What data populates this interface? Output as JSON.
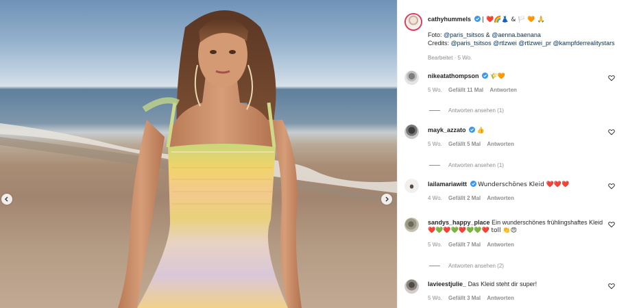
{
  "post": {
    "nav_prev_icon": "chevron-left-icon",
    "nav_next_icon": "chevron-right-icon"
  },
  "caption": {
    "username": "cathyhummels",
    "headline_emojis": "| ❤️🌈👗 & 🏳️ 🧡 🙏",
    "line1_prefix": "Foto: ",
    "line1_link1": "@paris_tsitsos",
    "line1_sep": " & ",
    "line1_link2": "@aenna.baenana",
    "line2_prefix": "Credits: ",
    "line2_links": "@paris_tsitsos @rtlzwei @rtlzwei_pr @kampfderrealitystars",
    "meta": "Bearbeitet · 5 Wo."
  },
  "labels": {
    "reply": "Antworten"
  },
  "comments": [
    {
      "username": "nikeatathompson",
      "verified": true,
      "text": "🌾🧡",
      "time": "5 Wo.",
      "likes": "Gefällt 11 Mal",
      "view_replies": "Antworten ansehen (1)"
    },
    {
      "username": "mayk_azzato",
      "verified": true,
      "text": "👍",
      "time": "5 Wo.",
      "likes": "Gefällt 5 Mal",
      "view_replies": "Antworten ansehen (1)"
    },
    {
      "username": "lailamariawitt",
      "verified": true,
      "text": "Wunderschönes Kleid ❤️❤️❤️",
      "time": "4 Wo.",
      "likes": "Gefällt 2 Mal"
    },
    {
      "username": "sandys_happy_place",
      "verified": false,
      "text": "Ein wunderschönes frühlingshaftes Kleid",
      "text2": "❤️💚❤️💚❤️💚💚❤️ toll 👏😍",
      "time": "5 Wo.",
      "likes": "Gefällt 7 Mal",
      "view_replies": "Antworten ansehen (2)"
    },
    {
      "username": "lavieestjulie_",
      "verified": false,
      "text": "Das Kleid steht dir super!",
      "time": "5 Wo.",
      "likes": "Gefällt 3 Mal"
    }
  ],
  "colors": {
    "verified": "#3897f0",
    "link": "#00376b",
    "meta": "#8e8e8e",
    "avatar_ring": "#e33b5a"
  }
}
